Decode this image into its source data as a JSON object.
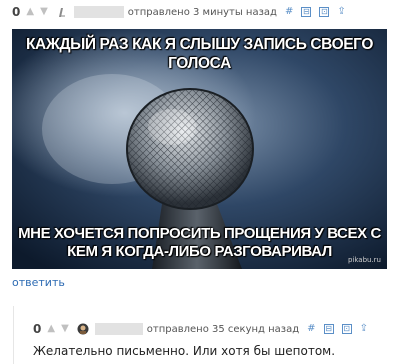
{
  "comment1": {
    "score": "0",
    "meta": "отправлено  3 минуты назад",
    "reply": "ответить",
    "meme_top": "Каждый раз как я слышу запись своего голоса",
    "meme_bottom": "Мне хочется попросить прощения у всех с кем я когда-либо разговаривал",
    "watermark": "pikabu.ru"
  },
  "comment2": {
    "score": "0",
    "meta": "отправлено  35 секунд назад",
    "text": "Желательно письменно. Или хотя бы шепотом."
  },
  "toolbar": {
    "hash": "#",
    "collapse": "⊟",
    "save": "⊡",
    "parent": "⇪"
  },
  "arrows": {
    "up": "▲",
    "down": "▼"
  }
}
